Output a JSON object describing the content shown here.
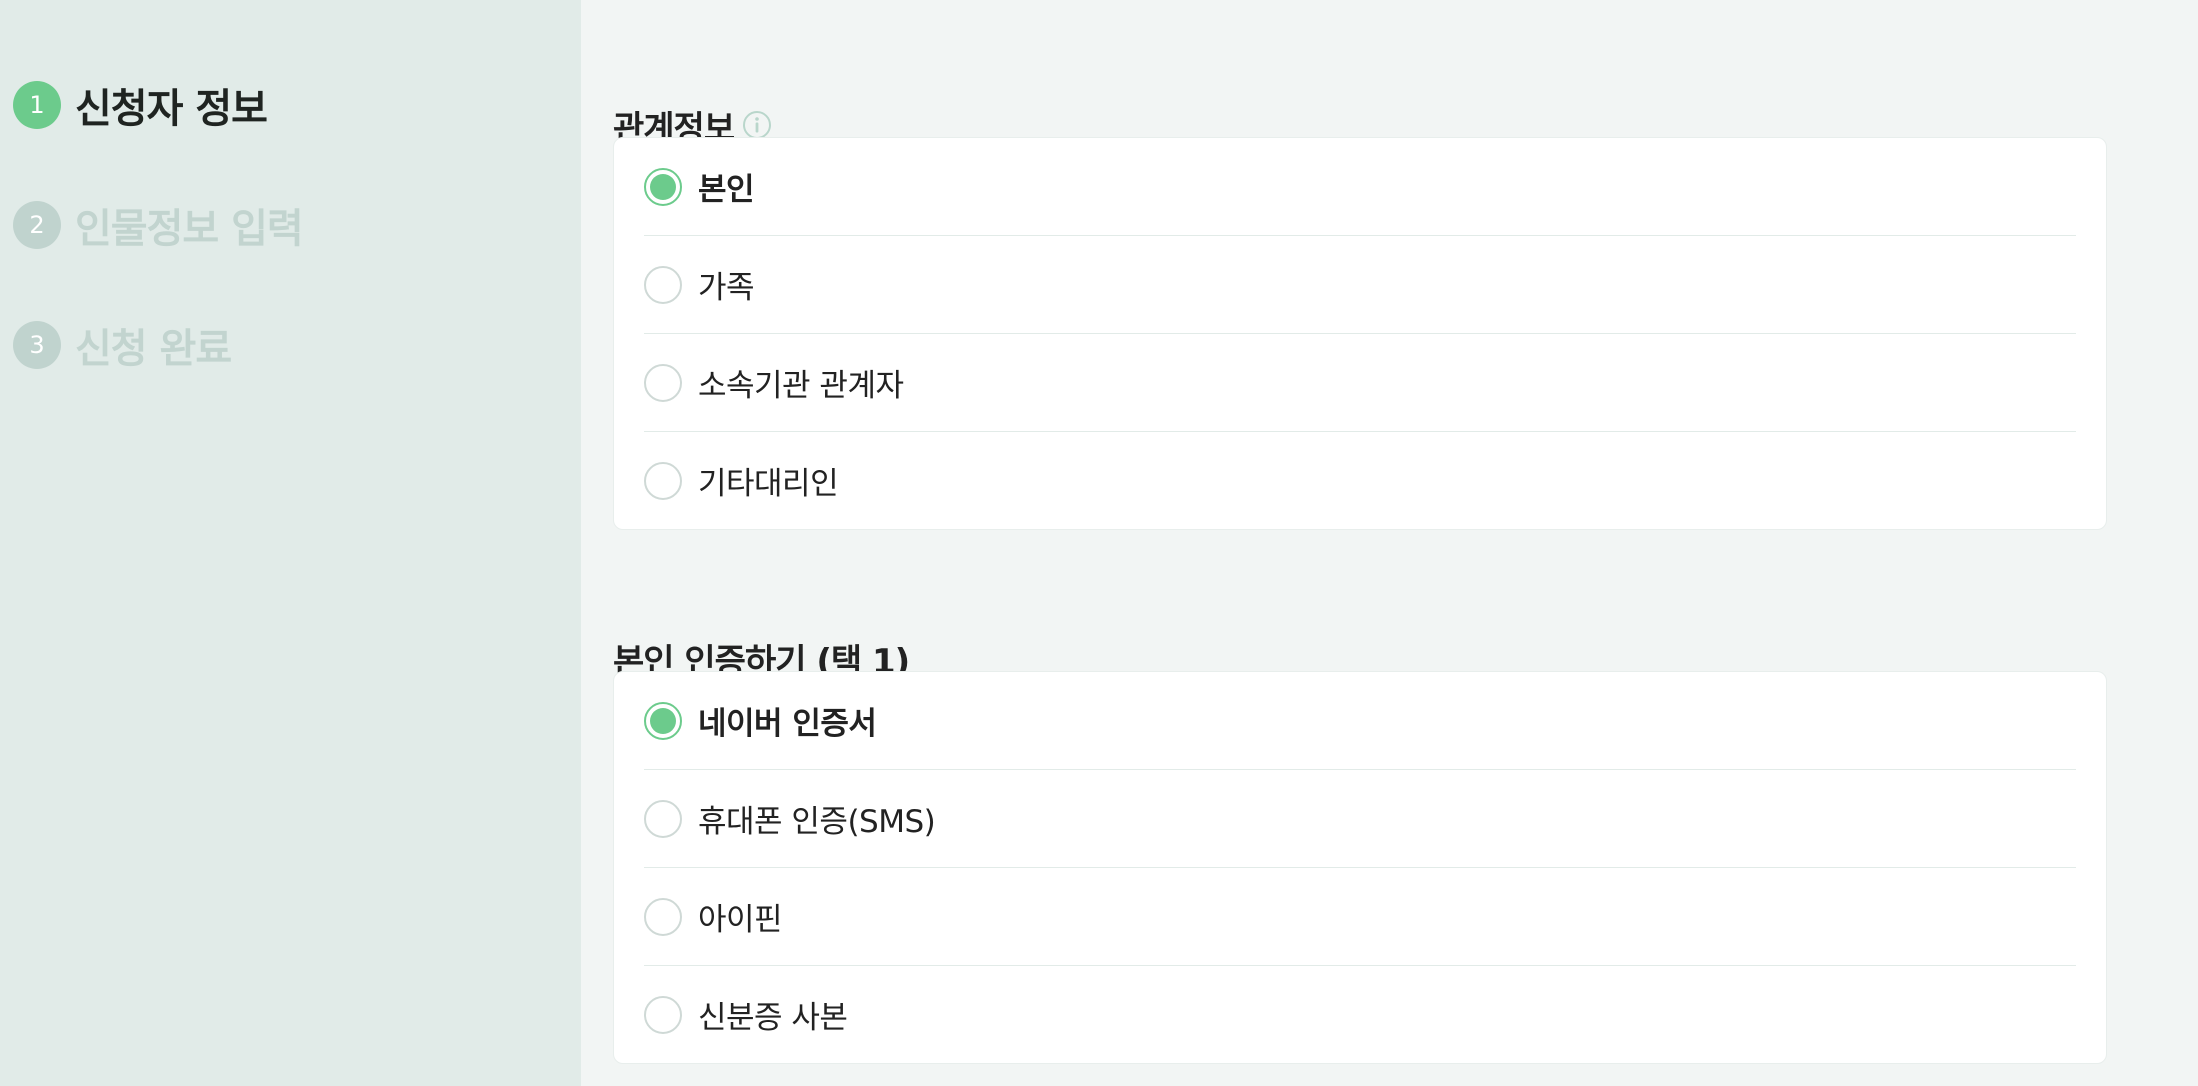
{
  "steps": [
    {
      "num": "1",
      "label": "신청자 정보",
      "state": "active"
    },
    {
      "num": "2",
      "label": "인물정보 입력",
      "state": "inactive"
    },
    {
      "num": "3",
      "label": "신청 완료",
      "state": "inactive"
    }
  ],
  "relation": {
    "title": "관계정보",
    "info_icon": "info-circle-icon",
    "options": [
      {
        "label": "본인",
        "selected": true
      },
      {
        "label": "가족",
        "selected": false
      },
      {
        "label": "소속기관 관계자",
        "selected": false
      },
      {
        "label": "기타대리인",
        "selected": false
      }
    ]
  },
  "auth": {
    "title": "본인 인증하기 (택 1)",
    "options": [
      {
        "label": "네이버 인증서",
        "selected": true
      },
      {
        "label": "휴대폰 인증(SMS)",
        "selected": false
      },
      {
        "label": "아이핀",
        "selected": false
      },
      {
        "label": "신분증 사본",
        "selected": false
      }
    ]
  },
  "colors": {
    "accent": "#6ccb8c",
    "sidebar_bg": "#e1ebe8",
    "main_bg": "#f2f5f4",
    "inactive_step": "#c2d4cf"
  }
}
